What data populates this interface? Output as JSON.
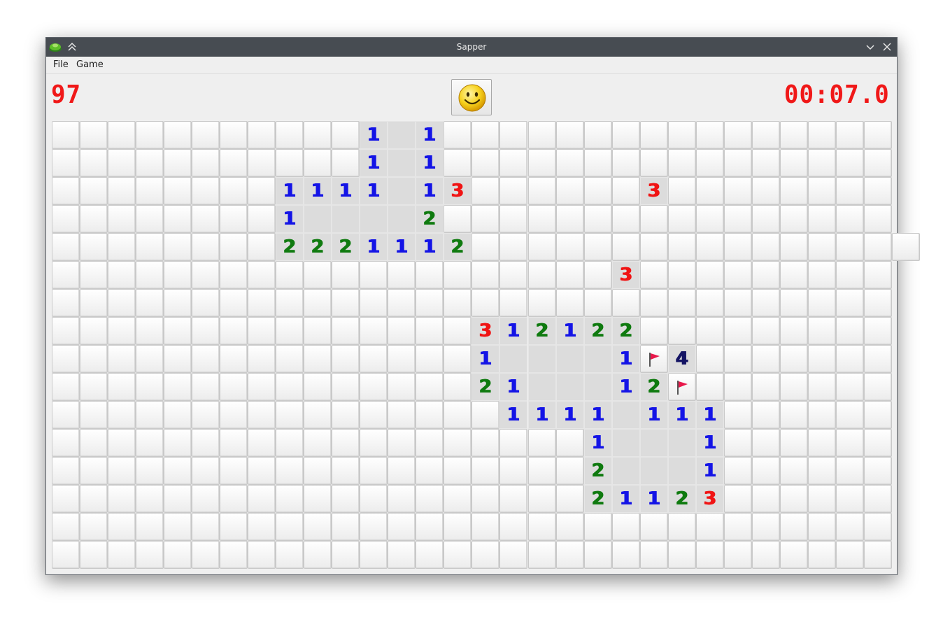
{
  "window": {
    "title": "Sapper",
    "app_icon": "sapper-app-icon",
    "keep_above_icon": "keep-above-icon",
    "minimize_icon": "minimize-icon",
    "close_icon": "close-icon"
  },
  "menu": {
    "items": [
      "File",
      "Game"
    ]
  },
  "status": {
    "mines_left": "97",
    "timer": "00:07.0",
    "face_icon": "smiley-face-icon",
    "digit_color": "#f01818"
  },
  "board": {
    "cols": 30,
    "rows": 16,
    "legend": "#=unopened, .=opened empty, 1-4=mine count, F=flag",
    "number_colors": {
      "1": "#1414e6",
      "2": "#0f7a0f",
      "3": "#f01414",
      "4": "#141464"
    },
    "grid": [
      "###########1.1################",
      "###########1.1################",
      "########1111.13######3########",
      "########1....2################",
      "########2221112################",
      "####################3#########",
      "##############################",
      "###############312122#########",
      "###############1....1F4#######",
      "###############21...12F#######",
      "################1111.111######",
      "###################1...1######",
      "###################2...1######",
      "###################21123######",
      "##############################",
      "##############################"
    ]
  }
}
